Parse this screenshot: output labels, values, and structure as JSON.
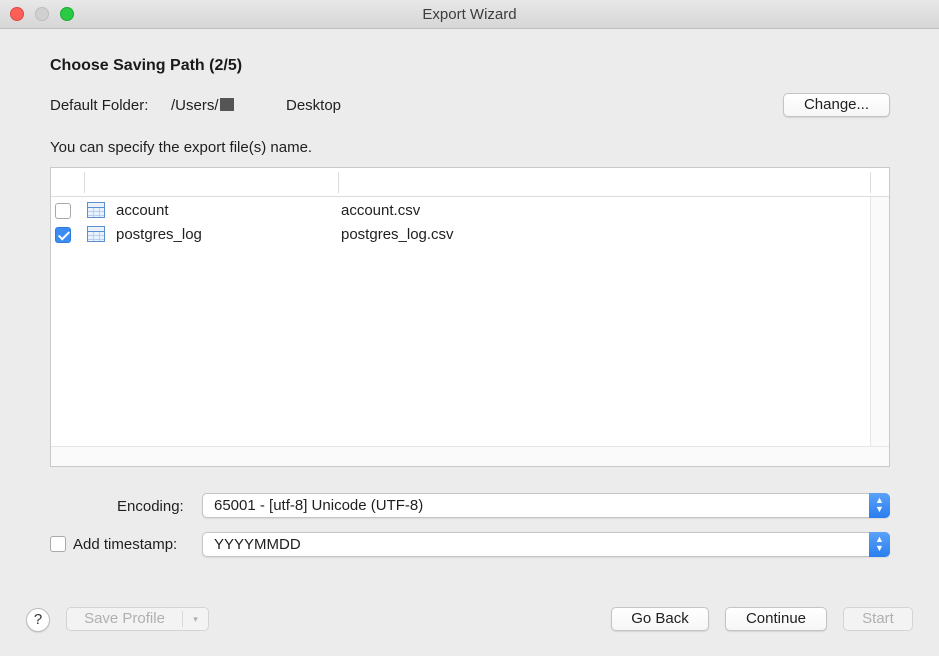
{
  "window": {
    "title": "Export Wizard"
  },
  "step": {
    "heading": "Choose Saving Path (2/5)"
  },
  "folder": {
    "label": "Default Folder:",
    "path_prefix": "/Users/",
    "path_suffix": "Desktop",
    "change_label": "Change..."
  },
  "hint": "You can specify the export file(s) name.",
  "table": {
    "rows": [
      {
        "name": "account",
        "file": "account.csv",
        "checked": false,
        "icon": "table-icon"
      },
      {
        "name": "postgres_log",
        "file": "postgres_log.csv",
        "checked": true,
        "icon": "table-icon"
      }
    ]
  },
  "encoding": {
    "label": "Encoding:",
    "value": "65001 - [utf-8] Unicode (UTF-8)"
  },
  "timestamp": {
    "label": "Add timestamp:",
    "value": "YYYYMMDD",
    "checked": false
  },
  "footer": {
    "help_label": "?",
    "save_profile_label": "Save Profile",
    "save_profile_arrow": "▾",
    "go_back_label": "Go Back",
    "continue_label": "Continue",
    "start_label": "Start"
  },
  "colors": {
    "accent": "#3b8df5",
    "close": "#fc5f57",
    "maximize": "#2acb42"
  }
}
